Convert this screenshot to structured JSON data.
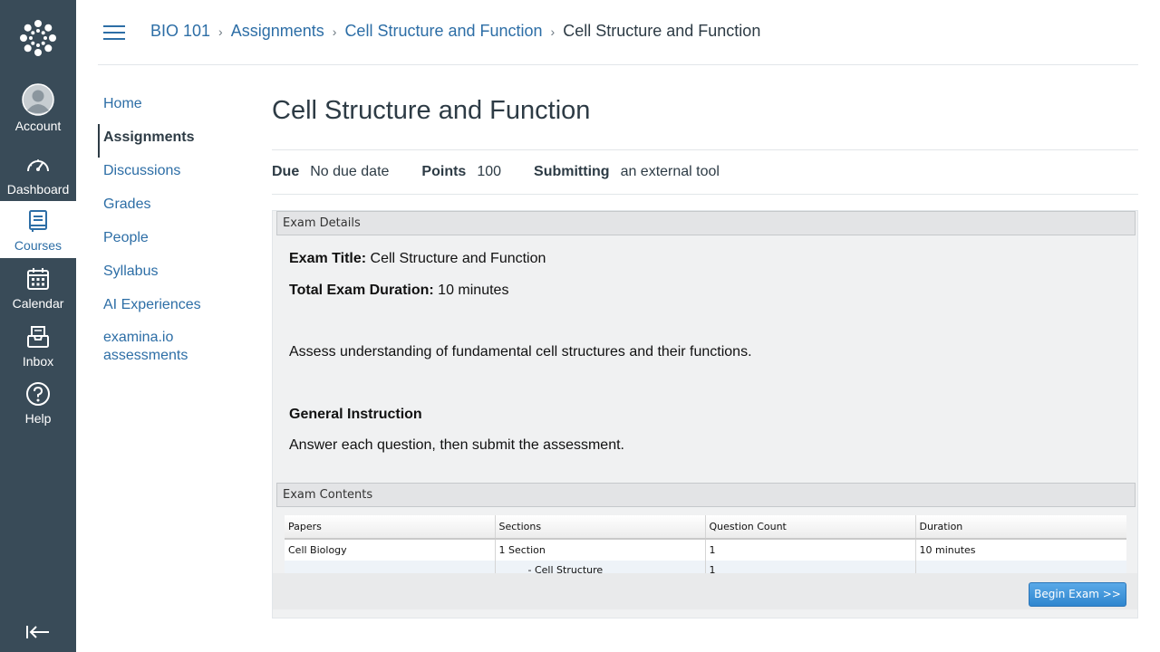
{
  "global_nav": {
    "items": [
      {
        "label": "Account",
        "icon": "account-avatar-icon"
      },
      {
        "label": "Dashboard",
        "icon": "dashboard-gauge-icon"
      },
      {
        "label": "Courses",
        "icon": "courses-book-icon",
        "active": true
      },
      {
        "label": "Calendar",
        "icon": "calendar-icon"
      },
      {
        "label": "Inbox",
        "icon": "inbox-icon"
      },
      {
        "label": "Help",
        "icon": "help-icon"
      }
    ],
    "colors": {
      "background": "#394b58",
      "active_text": "#2d6ea6"
    }
  },
  "breadcrumb": {
    "items": [
      "BIO 101",
      "Assignments",
      "Cell Structure and Function"
    ],
    "current": "Cell Structure and Function"
  },
  "course_nav": {
    "items": [
      "Home",
      "Assignments",
      "Discussions",
      "Grades",
      "People",
      "Syllabus",
      "AI Experiences",
      "examina.io assessments"
    ],
    "active": "Assignments"
  },
  "assignment": {
    "title": "Cell Structure and Function",
    "due_label": "Due",
    "due_value": "No due date",
    "points_label": "Points",
    "points_value": "100",
    "submitting_label": "Submitting",
    "submitting_value": "an external tool"
  },
  "exam": {
    "details_header": "Exam Details",
    "title_label": "Exam Title:",
    "title_value": "Cell Structure and Function",
    "duration_label": "Total Exam Duration:",
    "duration_value": "10 minutes",
    "description": "Assess understanding of fundamental cell structures and their functions.",
    "instruction_heading": "General Instruction",
    "instruction_text": "Answer each question, then submit the assessment.",
    "contents_header": "Exam Contents",
    "table": {
      "columns": [
        "Papers",
        "Sections",
        "Question Count",
        "Duration"
      ],
      "rows": [
        [
          "Cell Biology",
          "1 Section",
          "1",
          "10 minutes"
        ],
        [
          "",
          "- Cell Structure",
          "1",
          ""
        ]
      ]
    },
    "begin_button": "Begin Exam >>"
  }
}
